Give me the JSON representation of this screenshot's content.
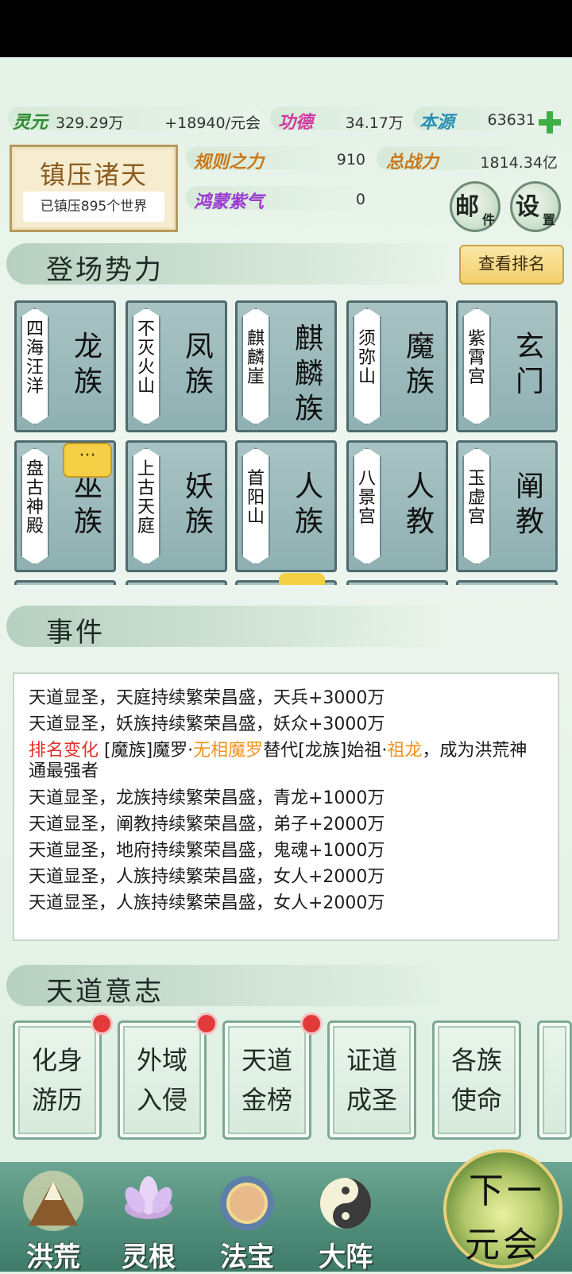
{
  "resources": {
    "lingyuan_label": "灵元",
    "lingyuan_value": "329.29万",
    "lingyuan_rate": "+18940/元会",
    "gongde_label": "功德",
    "gongde_value": "34.17万",
    "benyuan_label": "本源",
    "benyuan_value": "63631",
    "guize_label": "规则之力",
    "guize_value": "910",
    "zongzhanli_label": "总战力",
    "zongzhanli_value": "1814.34亿",
    "hongmeng_label": "鸿蒙紫气",
    "hongmeng_value": "0"
  },
  "seal": {
    "title": "镇压诸天",
    "subtitle": "已镇压895个世界"
  },
  "buttons": {
    "mail_big": "邮",
    "mail_small": "件",
    "settings_big": "设",
    "settings_small": "置",
    "rank": "查看排名"
  },
  "sections": {
    "factions": "登场势力",
    "events": "事件",
    "tiandao": "天道意志"
  },
  "factions": [
    {
      "place": "四海汪洋",
      "name": "龙族"
    },
    {
      "place": "不灭火山",
      "name": "凤族"
    },
    {
      "place": "麒麟崖",
      "name": "麒麟族"
    },
    {
      "place": "须弥山",
      "name": "魔族"
    },
    {
      "place": "紫霄宫",
      "name": "玄门"
    },
    {
      "place": "盘古神殿",
      "name": "巫族"
    },
    {
      "place": "上古天庭",
      "name": "妖族"
    },
    {
      "place": "首阳山",
      "name": "人族"
    },
    {
      "place": "八景宫",
      "name": "人教"
    },
    {
      "place": "玉虚宫",
      "name": "阐教"
    }
  ],
  "bubble_text": "···",
  "events": {
    "line1": "天道显圣，天庭持续繁荣昌盛，天兵+3000万",
    "line2": "天道显圣，妖族持续繁荣昌盛，妖众+3000万",
    "rank_prefix": "排名变化",
    "rank_part1": " [魔族]魔罗·",
    "rank_part2": "无相魔罗",
    "rank_part3": "替代[龙族]始祖·",
    "rank_part4": "祖龙",
    "rank_part5": "，成为洪荒神通最强者",
    "line4": "天道显圣，龙族持续繁荣昌盛，青龙+1000万",
    "line5": "天道显圣，阐教持续繁荣昌盛，弟子+2000万",
    "line6": "天道显圣，地府持续繁荣昌盛，鬼魂+1000万",
    "line7": "天道显圣，人族持续繁荣昌盛，女人+2000万",
    "line8": "天道显圣，人族持续繁荣昌盛，女人+2000万"
  },
  "tiandao": [
    {
      "line1": "化身",
      "line2": "游历"
    },
    {
      "line1": "外域",
      "line2": "入侵"
    },
    {
      "line1": "天道",
      "line2": "金榜"
    },
    {
      "line1": "证道",
      "line2": "成圣"
    },
    {
      "line1": "各族",
      "line2": "使命"
    }
  ],
  "nav": {
    "honghuang": "洪荒",
    "linggen": "灵根",
    "fabao": "法宝",
    "dazhen": "大阵"
  },
  "next": {
    "line1": "下一",
    "line2": "元会"
  },
  "colors": {
    "accent_gold": "#f1cf6a",
    "event_red": "#e0302a",
    "event_orange": "#f0931a",
    "nav_green": "#3e7b68"
  }
}
